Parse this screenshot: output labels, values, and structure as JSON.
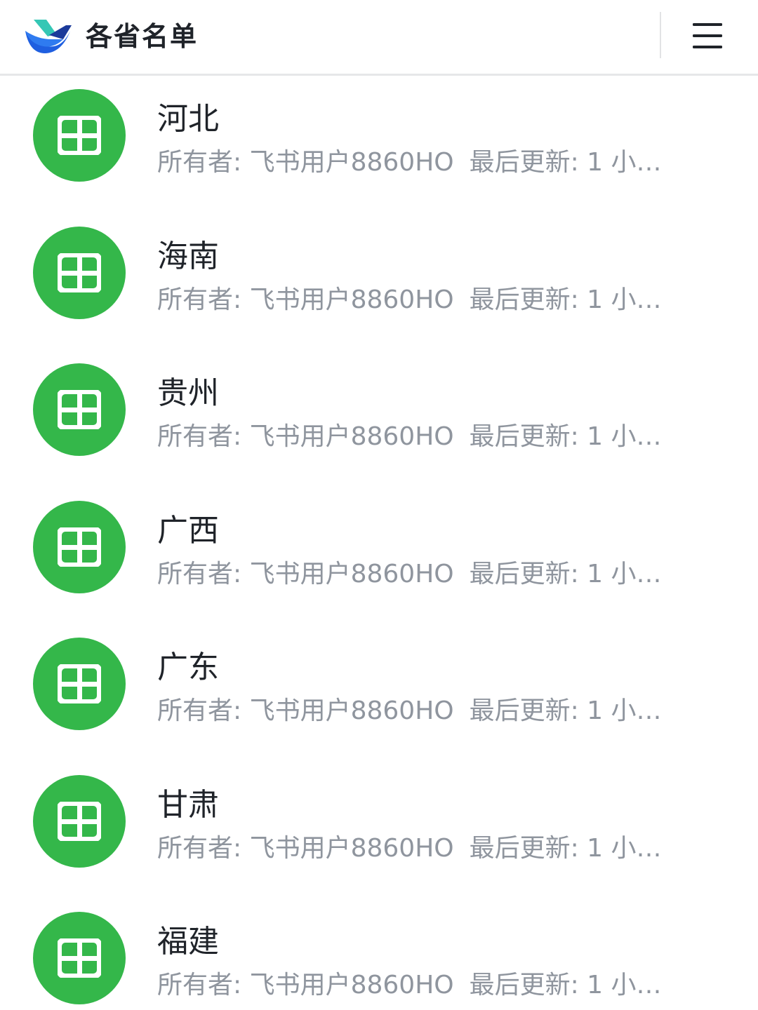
{
  "header": {
    "title": "各省名单",
    "logo_icon": "feishu-bird-logo",
    "menu_icon": "hamburger-menu-icon"
  },
  "colors": {
    "sheet_icon_bg": "#34b74a",
    "title_text": "#1f2329",
    "meta_text": "#8f959e",
    "logo_blue": "#1f5fe0",
    "logo_teal": "#35c7b5"
  },
  "list": {
    "items": [
      {
        "title": "河北",
        "owner": "所有者: 飞书用户8860HO",
        "updated": "最后更新: 1 小…",
        "icon": "sheet-grid-icon"
      },
      {
        "title": "海南",
        "owner": "所有者: 飞书用户8860HO",
        "updated": "最后更新: 1 小…",
        "icon": "sheet-grid-icon"
      },
      {
        "title": "贵州",
        "owner": "所有者: 飞书用户8860HO",
        "updated": "最后更新: 1 小…",
        "icon": "sheet-grid-icon"
      },
      {
        "title": "广西",
        "owner": "所有者: 飞书用户8860HO",
        "updated": "最后更新: 1 小…",
        "icon": "sheet-grid-icon"
      },
      {
        "title": "广东",
        "owner": "所有者: 飞书用户8860HO",
        "updated": "最后更新: 1 小…",
        "icon": "sheet-grid-icon"
      },
      {
        "title": "甘肃",
        "owner": "所有者: 飞书用户8860HO",
        "updated": "最后更新: 1 小…",
        "icon": "sheet-grid-icon"
      },
      {
        "title": "福建",
        "owner": "所有者: 飞书用户8860HO",
        "updated": "最后更新: 1 小…",
        "icon": "sheet-grid-icon"
      }
    ]
  }
}
